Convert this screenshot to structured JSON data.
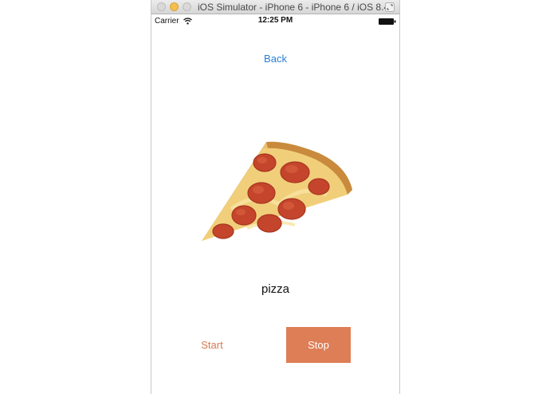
{
  "window": {
    "title": "iOS Simulator - iPhone 6 - iPhone 6 / iOS 8.4..."
  },
  "status_bar": {
    "carrier": "Carrier",
    "time": "12:25 PM"
  },
  "app": {
    "back_label": "Back",
    "food_label": "pizza",
    "start_label": "Start",
    "stop_label": "Stop",
    "image_icon": "pizza-slice-image"
  },
  "colors": {
    "link": "#2a7fd4",
    "accent": "#de7e56",
    "start_text": "#d8794f"
  }
}
